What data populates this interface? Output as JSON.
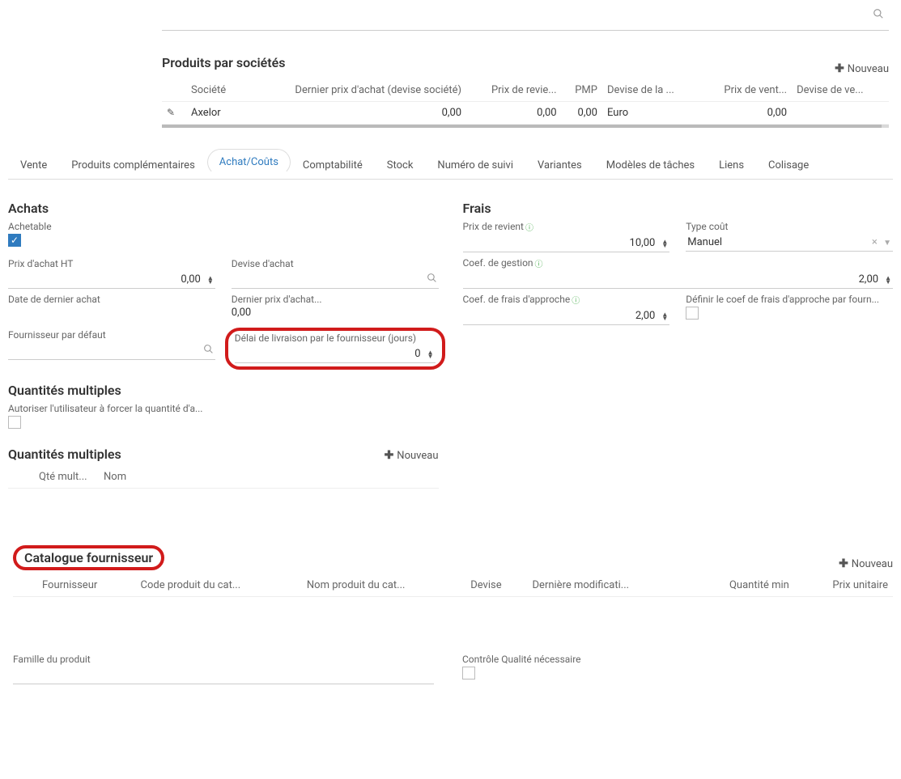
{
  "topSearch": {
    "icon": "search-icon"
  },
  "produitsSociete": {
    "title": "Produits par sociétés",
    "addNew": "Nouveau",
    "headers": {
      "societe": "Société",
      "dernierPrixAchat": "Dernier prix d'achat (devise société)",
      "prixRevie": "Prix de revie...",
      "pmp": "PMP",
      "deviseDeLa": "Devise de la ...",
      "prixVent": "Prix de vent...",
      "deviseDeVe": "Devise de ve..."
    },
    "row": {
      "societe": "Axelor",
      "dernierPrixAchat": "0,00",
      "prixRevie": "0,00",
      "pmp": "0,00",
      "deviseDeLa": "Euro",
      "prixVent": "0,00",
      "deviseDeVe": ""
    }
  },
  "tabs": {
    "vente": "Vente",
    "produitsComp": "Produits complémentaires",
    "achatCouts": "Achat/Coûts",
    "comptabilite": "Comptabilité",
    "stock": "Stock",
    "numeroSuivi": "Numéro de suivi",
    "variantes": "Variantes",
    "modelesTaches": "Modèles de tâches",
    "liens": "Liens",
    "colisage": "Colisage"
  },
  "achats": {
    "title": "Achats",
    "achetable": "Achetable",
    "prixAchatHT": {
      "label": "Prix d'achat HT",
      "value": "0,00"
    },
    "deviseAchat": {
      "label": "Devise d'achat"
    },
    "dateDernierAchat": {
      "label": "Date de dernier achat"
    },
    "dernierPrixAchat": {
      "label": "Dernier prix d'achat...",
      "value": "0,00"
    },
    "fournisseurDefaut": {
      "label": "Fournisseur par défaut"
    },
    "delaiLivraison": {
      "label": "Délai de livraison par le fournisseur (jours)",
      "value": "0"
    }
  },
  "quantitesMultiples": {
    "title": "Quantités multiples",
    "autoriser": "Autoriser l'utilisateur à forcer la quantité d'a...",
    "tableTitle": "Quantités multiples",
    "addNew": "Nouveau",
    "headers": {
      "qteMult": "Qté mult...",
      "nom": "Nom"
    }
  },
  "frais": {
    "title": "Frais",
    "prixRevient": {
      "label": "Prix de revient",
      "value": "10,00"
    },
    "typeCout": {
      "label": "Type coût",
      "value": "Manuel"
    },
    "coefGestion": {
      "label": "Coef. de gestion",
      "value": "2,00"
    },
    "coefFraisApproche": {
      "label": "Coef. de frais d'approche",
      "value": "2,00"
    },
    "definirCoef": {
      "label": "Définir le coef de frais d'approche par fourn..."
    }
  },
  "catalogueFournisseur": {
    "title": "Catalogue fournisseur",
    "addNew": "Nouveau",
    "headers": {
      "fournisseur": "Fournisseur",
      "codeProduit": "Code produit du cat...",
      "nomProduit": "Nom produit du cat...",
      "devise": "Devise",
      "derniereModif": "Dernière modificati...",
      "quantiteMin": "Quantité min",
      "prixUnitaire": "Prix unitaire"
    }
  },
  "famille": {
    "familleProduit": "Famille du produit",
    "controleQualite": "Contrôle Qualité nécessaire"
  }
}
